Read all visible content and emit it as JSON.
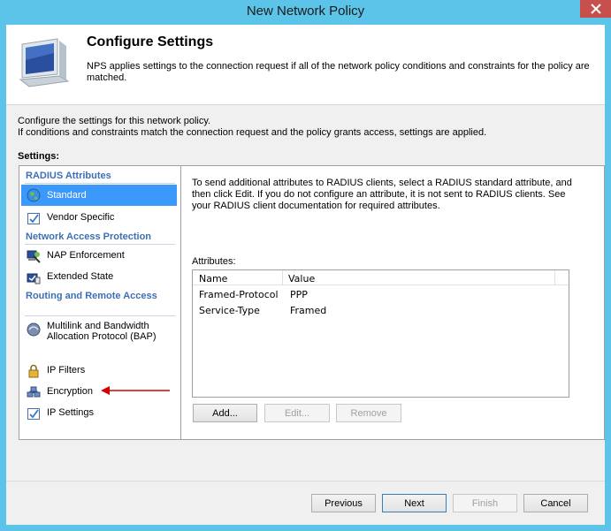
{
  "window": {
    "title": "New Network Policy"
  },
  "header": {
    "title": "Configure Settings",
    "description": "NPS applies settings to the connection request if all of the network policy conditions and constraints for the policy are matched."
  },
  "intro": {
    "line1": "Configure the settings for this network policy.",
    "line2": "If conditions and constraints match the connection request and the policy grants access, settings are applied."
  },
  "settings_label": "Settings:",
  "sidebar": {
    "categories": [
      {
        "label": "RADIUS Attributes"
      },
      {
        "label": "Network Access Protection"
      },
      {
        "label": "Routing and Remote Access"
      }
    ],
    "items": [
      {
        "label": "Standard",
        "icon": "globe-icon",
        "selected": true
      },
      {
        "label": "Vendor Specific",
        "icon": "checklist-icon"
      },
      {
        "label": "NAP Enforcement",
        "icon": "nap-enforcement-icon"
      },
      {
        "label": "Extended State",
        "icon": "extended-state-icon"
      },
      {
        "label": "Multilink and Bandwidth Allocation Protocol (BAP)",
        "icon": "multilink-icon"
      },
      {
        "label": "IP Filters",
        "icon": "lock-icon"
      },
      {
        "label": "Encryption",
        "icon": "encryption-icon"
      },
      {
        "label": "IP Settings",
        "icon": "checklist-icon"
      }
    ]
  },
  "main": {
    "description": "To send additional attributes to RADIUS clients, select a RADIUS standard attribute, and then click Edit. If you do not configure an attribute, it is not sent to RADIUS clients. See your RADIUS client documentation for required attributes.",
    "attributes_label": "Attributes:",
    "columns": [
      "Name",
      "Value"
    ],
    "rows": [
      {
        "name": "Framed-Protocol",
        "value": "PPP"
      },
      {
        "name": "Service-Type",
        "value": "Framed"
      }
    ],
    "buttons": {
      "add": "Add...",
      "edit": "Edit...",
      "remove": "Remove"
    }
  },
  "footer": {
    "previous": "Previous",
    "next": "Next",
    "finish": "Finish",
    "cancel": "Cancel"
  },
  "colors": {
    "titlebar": "#5cc4e8",
    "selection": "#3b99fc",
    "category_text": "#3e6fb5",
    "arrow": "#d40000"
  }
}
